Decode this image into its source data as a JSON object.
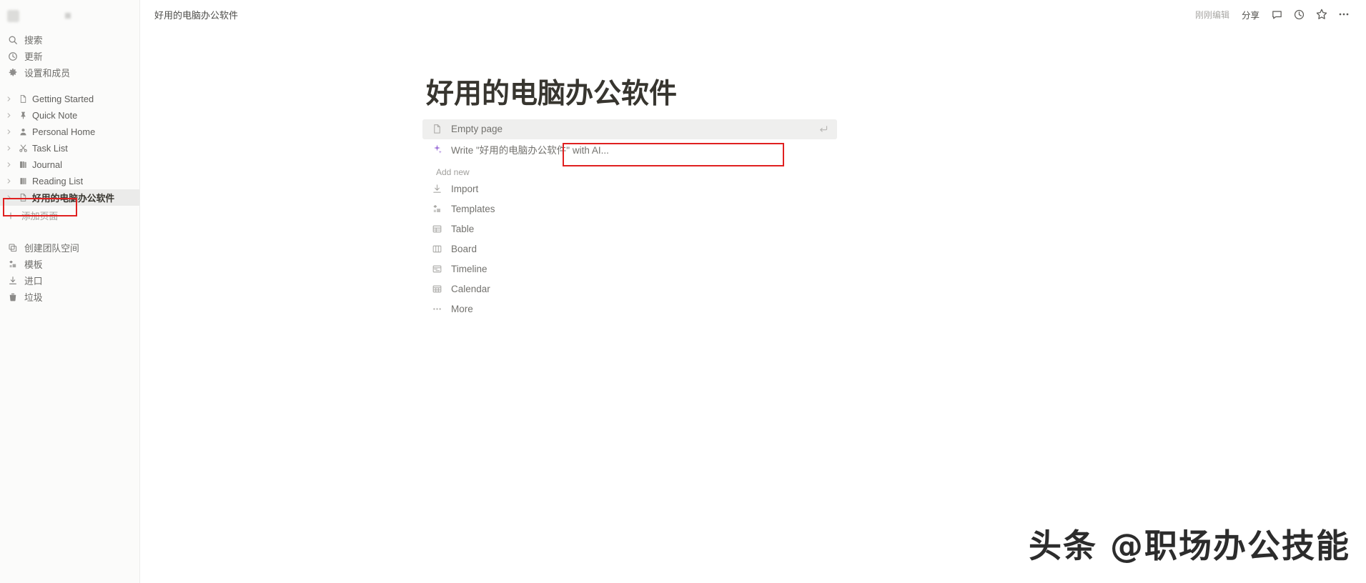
{
  "sidebar": {
    "workspace": {
      "name": "",
      "blurred": true
    },
    "top_items": [
      {
        "label": "搜索",
        "icon": "search-icon",
        "name": "sidebar-item-search"
      },
      {
        "label": "更新",
        "icon": "clock-icon",
        "name": "sidebar-item-updates"
      },
      {
        "label": "设置和成员",
        "icon": "gear-icon",
        "name": "sidebar-item-settings-members"
      }
    ],
    "pages": [
      {
        "label": "Getting Started",
        "icon": "document-icon",
        "active": false
      },
      {
        "label": "Quick Note",
        "icon": "pin-icon",
        "active": false
      },
      {
        "label": "Personal Home",
        "icon": "person-icon",
        "active": false
      },
      {
        "label": "Task List",
        "icon": "scissors-icon",
        "active": false
      },
      {
        "label": "Journal",
        "icon": "book-icon",
        "active": false
      },
      {
        "label": "Reading List",
        "icon": "books-icon",
        "active": false
      },
      {
        "label": "好用的电脑办公软件",
        "icon": "document-icon",
        "active": true
      }
    ],
    "add_page": {
      "label": "添加页面",
      "icon": "plus-icon"
    },
    "bottom_items": [
      {
        "label": "创建团队空间",
        "icon": "teamspace-icon"
      },
      {
        "label": "模板",
        "icon": "templates-icon"
      },
      {
        "label": "进口",
        "icon": "import-icon"
      },
      {
        "label": "垃圾",
        "icon": "trash-icon"
      }
    ]
  },
  "topbar": {
    "breadcrumb": "好用的电脑办公软件",
    "edited_label": "刚刚编辑",
    "share_label": "分享",
    "icons": [
      "comment-icon",
      "history-icon",
      "star-icon",
      "more-icon"
    ]
  },
  "main": {
    "page_title": "好用的电脑办公软件",
    "suggestions": [
      {
        "label": "Empty page",
        "icon": "document-icon",
        "highlighted": true,
        "enter_hint": true
      },
      {
        "label": "Write \"好用的电脑办公软件\" with AI...",
        "icon": "ai-sparkle-icon",
        "highlighted": false,
        "annotated": true
      }
    ],
    "add_new_heading": "Add new",
    "add_new_items": [
      {
        "label": "Import",
        "icon": "import-icon"
      },
      {
        "label": "Templates",
        "icon": "templates-icon"
      },
      {
        "label": "Table",
        "icon": "table-icon"
      },
      {
        "label": "Board",
        "icon": "board-icon"
      },
      {
        "label": "Timeline",
        "icon": "timeline-icon"
      },
      {
        "label": "Calendar",
        "icon": "calendar-icon"
      },
      {
        "label": "More",
        "icon": "more-icon"
      }
    ]
  },
  "watermark": {
    "text": "头条 @职场办公技能"
  },
  "colors": {
    "annotation_red": "#e02020",
    "sidebar_bg": "#fbfbfa",
    "active_row_bg": "#ebebea",
    "text_primary": "#37352f",
    "text_muted": "#8a8987",
    "ai_purple": "#9a6dd7"
  }
}
